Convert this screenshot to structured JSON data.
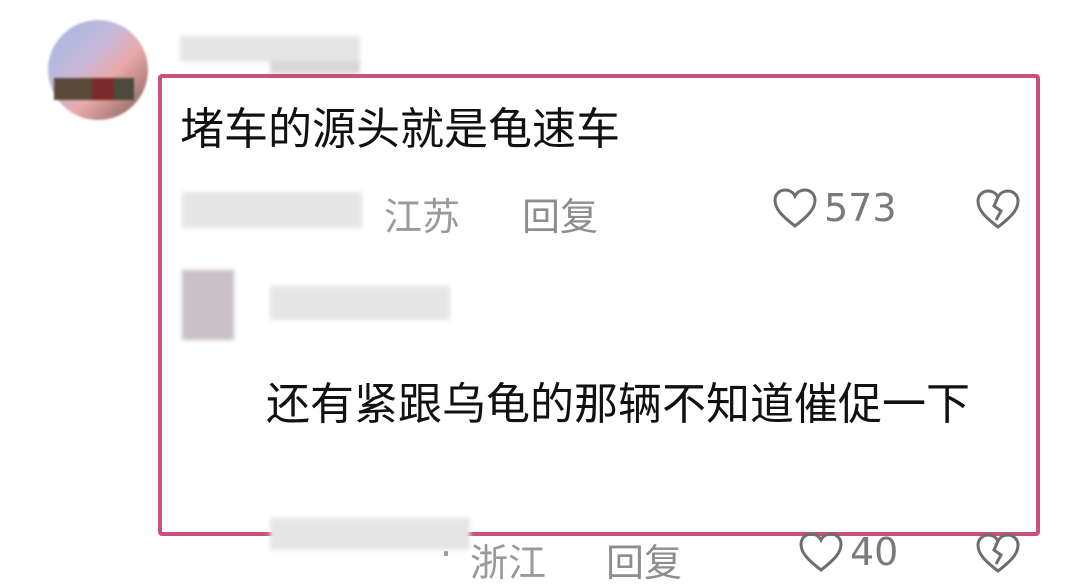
{
  "comment": {
    "text": "堵车的源头就是龟速车",
    "location": "江苏",
    "reply_label": "回复",
    "like_count": "573"
  },
  "reply": {
    "text": "还有紧跟乌龟的那辆不知道催促一下"
  },
  "next_comment": {
    "location": "浙江",
    "separator": "·",
    "reply_label": "回复",
    "like_count": "40"
  },
  "icons": {
    "like": "heart-outline-icon",
    "dislike": "broken-heart-icon"
  },
  "colors": {
    "highlight_border": "#c8517e",
    "meta_text": "#9a9a9a"
  }
}
